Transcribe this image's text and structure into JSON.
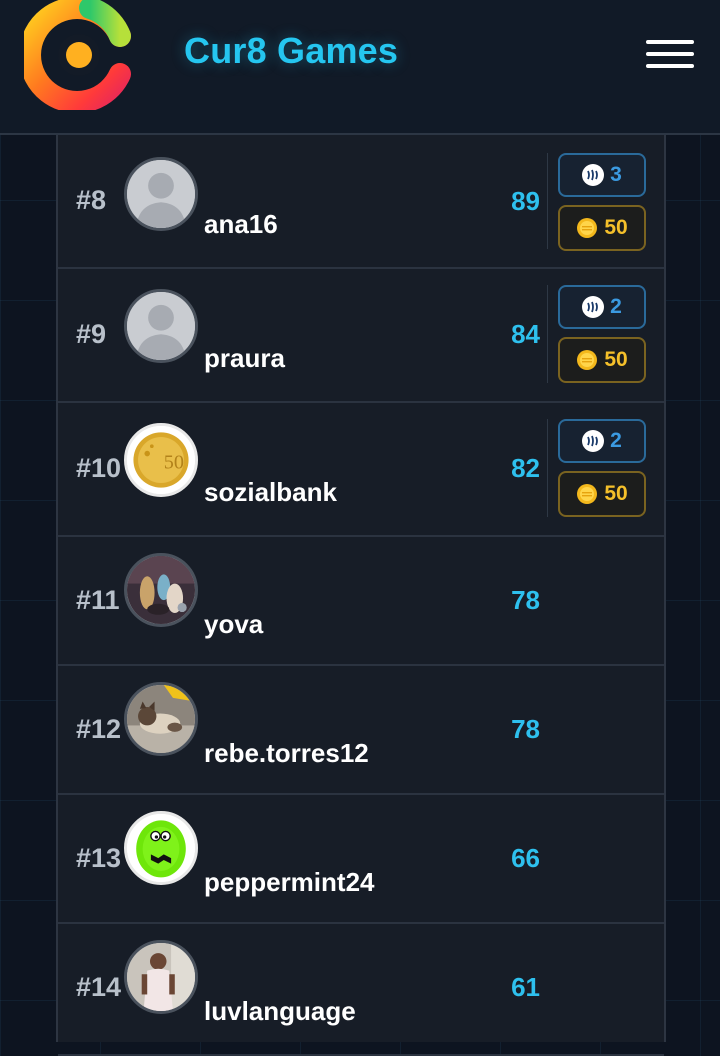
{
  "header": {
    "brand": "Cur8 Games",
    "logo_icon": "cur8-logo-icon",
    "menu_icon": "hamburger-menu-icon"
  },
  "colors": {
    "accent": "#25c6f0",
    "score": "#2ec0ee",
    "steem": "#3b9ae1",
    "coin": "#f5c02a",
    "background": "#0d1420",
    "panel": "#171d27"
  },
  "leaderboard": [
    {
      "rank": "#8",
      "username": "ana16",
      "score": "89",
      "avatar": "default-avatar-icon",
      "steem": "3",
      "coins": "50"
    },
    {
      "rank": "#9",
      "username": "praura",
      "score": "84",
      "avatar": "default-avatar-icon",
      "steem": "2",
      "coins": "50"
    },
    {
      "rank": "#10",
      "username": "sozialbank",
      "score": "82",
      "avatar": "euro-coin-avatar",
      "steem": "2",
      "coins": "50"
    },
    {
      "rank": "#11",
      "username": "yova",
      "score": "78",
      "avatar": "figurines-photo-avatar"
    },
    {
      "rank": "#12",
      "username": "rebe.torres12",
      "score": "78",
      "avatar": "cat-photo-avatar"
    },
    {
      "rank": "#13",
      "username": "peppermint24",
      "score": "66",
      "avatar": "green-monster-avatar"
    },
    {
      "rank": "#14",
      "username": "luvlanguage",
      "score": "61",
      "avatar": "person-photo-avatar"
    }
  ]
}
